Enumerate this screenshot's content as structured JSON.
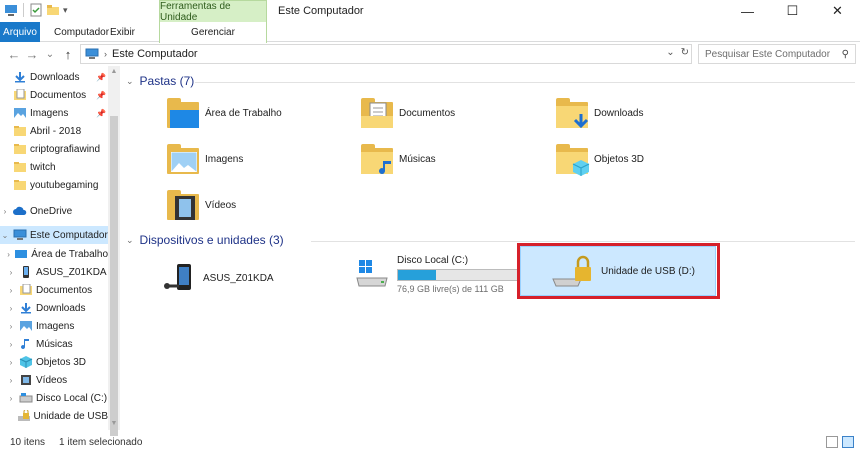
{
  "window": {
    "title": "Este Computador",
    "tools_tab": "Ferramentas de Unidade",
    "minimize": "—",
    "maximize": "☐",
    "close": "✕"
  },
  "ribbon": {
    "tabs": [
      "Arquivo",
      "Computador",
      "Exibir",
      "Gerenciar"
    ]
  },
  "address": {
    "back": "←",
    "forward": "→",
    "recent": "⌄",
    "up": "↑",
    "path": "Este Computador",
    "search_placeholder": "Pesquisar Este Computador"
  },
  "sidebar": {
    "items": [
      {
        "label": "Downloads",
        "pinned": true,
        "icon": "download-arrow-icon"
      },
      {
        "label": "Documentos",
        "pinned": true,
        "icon": "document-icon"
      },
      {
        "label": "Imagens",
        "pinned": true,
        "icon": "pictures-icon"
      },
      {
        "label": "Abril - 2018",
        "icon": "folder-icon"
      },
      {
        "label": "criptografiawind",
        "icon": "folder-icon"
      },
      {
        "label": "twitch",
        "icon": "folder-icon"
      },
      {
        "label": "youtubegaming",
        "icon": "folder-icon"
      },
      {
        "label": "OneDrive",
        "icon": "cloud-icon"
      },
      {
        "label": "Este Computador",
        "icon": "computer-icon",
        "selected": true
      },
      {
        "label": "Área de Trabalho",
        "icon": "desktop-icon"
      },
      {
        "label": "ASUS_Z01KDA",
        "icon": "phone-icon"
      },
      {
        "label": "Documentos",
        "icon": "document-icon"
      },
      {
        "label": "Downloads",
        "icon": "download-arrow-icon"
      },
      {
        "label": "Imagens",
        "icon": "pictures-icon"
      },
      {
        "label": "Músicas",
        "icon": "music-icon"
      },
      {
        "label": "Objetos 3D",
        "icon": "cube-icon"
      },
      {
        "label": "Vídeos",
        "icon": "video-icon"
      },
      {
        "label": "Disco Local (C:)",
        "icon": "drive-icon"
      },
      {
        "label": "Unidade de USB",
        "icon": "usb-lock-icon"
      }
    ]
  },
  "main": {
    "folders_header": "Pastas (7)",
    "folders": [
      {
        "label": "Área de Trabalho",
        "icon": "desktop-icon"
      },
      {
        "label": "Documentos",
        "icon": "document-icon"
      },
      {
        "label": "Downloads",
        "icon": "download-arrow-icon"
      },
      {
        "label": "Imagens",
        "icon": "pictures-icon"
      },
      {
        "label": "Músicas",
        "icon": "music-icon"
      },
      {
        "label": "Objetos 3D",
        "icon": "cube-icon"
      },
      {
        "label": "Vídeos",
        "icon": "video-icon"
      }
    ],
    "devices_header": "Dispositivos e unidades (3)",
    "devices": [
      {
        "label": "ASUS_Z01KDA",
        "icon": "phone-icon"
      },
      {
        "label": "Disco Local (C:)",
        "icon": "windows-drive-icon",
        "free_text": "76,9 GB livre(s) de 111 GB",
        "used_fraction": 0.31
      },
      {
        "label": "Unidade de USB (D:)",
        "icon": "usb-lock-icon",
        "selected": true
      }
    ]
  },
  "status": {
    "count": "10 itens",
    "selection": "1 item selecionado"
  },
  "colors": {
    "accent": "#1979ca",
    "selection": "#cce8ff",
    "highlight_box": "#d6202a",
    "tools_tab": "#d6efc6"
  }
}
